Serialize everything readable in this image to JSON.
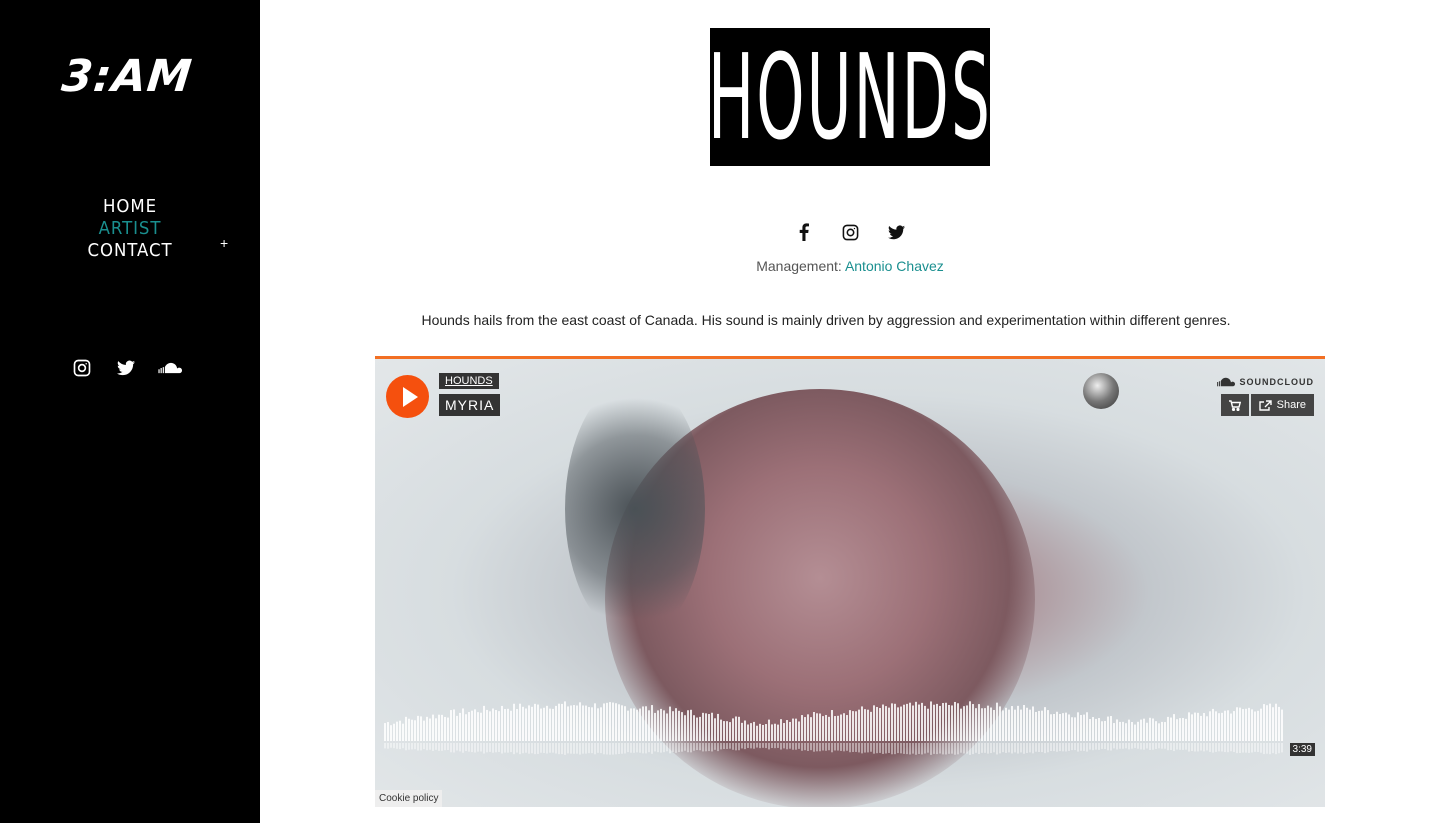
{
  "sidebar": {
    "logo": "3:AM",
    "nav": [
      {
        "label": "HOME"
      },
      {
        "label": "ARTIST"
      },
      {
        "label": "CONTACT"
      }
    ],
    "expand_symbol": "+",
    "social_icons": [
      "instagram-icon",
      "twitter-icon",
      "soundcloud-icon"
    ]
  },
  "main": {
    "artist_logo_text": "HOUNDS",
    "social_icons": [
      "facebook-icon",
      "instagram-icon",
      "twitter-icon"
    ],
    "management_label": "Management:",
    "management_name": "Antonio Chavez",
    "bio": "Hounds hails from the east coast of Canada. His sound is mainly driven by aggression and experimentation within different genres."
  },
  "player": {
    "artist": "HOUNDS",
    "track": "MYRIA",
    "brand": "SOUNDCLOUD",
    "share_label": "Share",
    "duration": "3:39",
    "cookie_label": "Cookie policy",
    "accent": "#f5500e"
  },
  "colors": {
    "sidebar_bg": "#000000",
    "link": "#1a8f8f"
  }
}
